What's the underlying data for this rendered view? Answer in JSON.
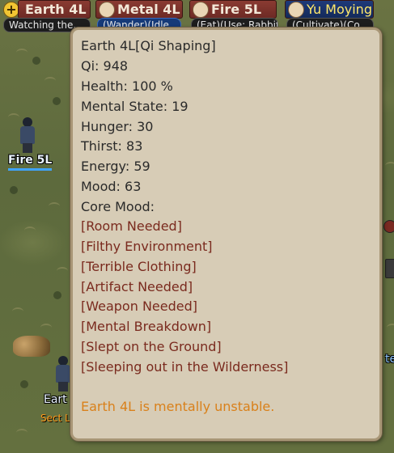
{
  "characters": [
    {
      "name": "Earth 4L",
      "sub": "Watching the..."
    },
    {
      "name": "Metal 4L",
      "sub": "(Wander)(Idle..."
    },
    {
      "name": "Fire 5L",
      "sub": "(Eat)(Use: Rabbit..."
    },
    {
      "name": "Yu Moying",
      "sub": "(Cultivate)(Co..."
    }
  ],
  "world_labels": {
    "fire_name": "Fire 5L",
    "earth_name": "Eart",
    "earth_role": "Sect L",
    "edge_glyph": "te"
  },
  "tooltip": {
    "title": "Earth 4L[Qi Shaping]",
    "stats": [
      "Qi: 948",
      "Health: 100 %",
      "Mental State: 19",
      "Hunger: 30",
      "Thirst: 83",
      "Energy: 59",
      "Mood: 63",
      "Core Mood:"
    ],
    "core_moods": [
      "[Room Needed]",
      "[Filthy Environment]",
      "[Terrible Clothing]",
      "[Artifact Needed]",
      "[Weapon Needed]",
      "[Mental Breakdown]",
      "[Slept on the Ground]",
      "[Sleeping out in the Wilderness]"
    ],
    "warning": "Earth 4L is mentally unstable."
  },
  "icons": {
    "add": "plus-circle-icon",
    "portrait": "character-portrait-icon"
  },
  "colors": {
    "tooltip_bg": "#d7ccb6",
    "mood_text": "#7a2a1e",
    "warning_text": "#d9801a",
    "name_blue": "#3fa4ff"
  }
}
